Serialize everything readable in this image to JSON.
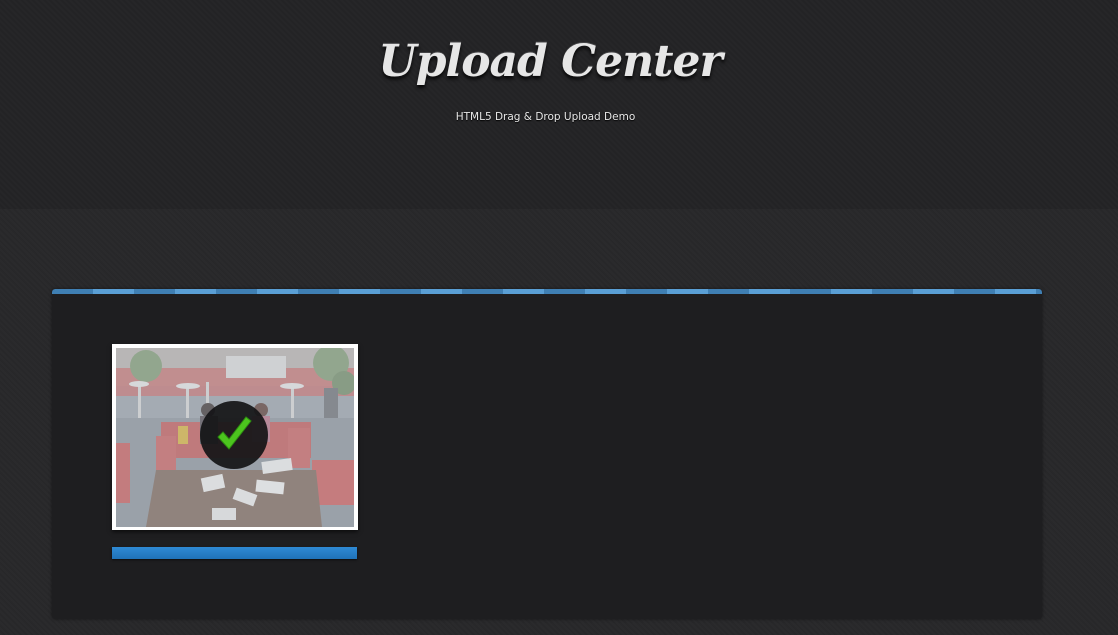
{
  "header": {
    "title": "Upload Center",
    "subtitle": "HTML5 Drag & Drop Upload Demo"
  },
  "colors": {
    "accent_stripe_dark": "#3f7fb3",
    "accent_stripe_light": "#5a9fd5",
    "progress_fill": "#2f8ad4",
    "check_green": "#4cc51e"
  },
  "uploads": [
    {
      "preview": "uploaded-photo",
      "status_icon": "checkmark-icon",
      "progress": 1.0
    }
  ]
}
